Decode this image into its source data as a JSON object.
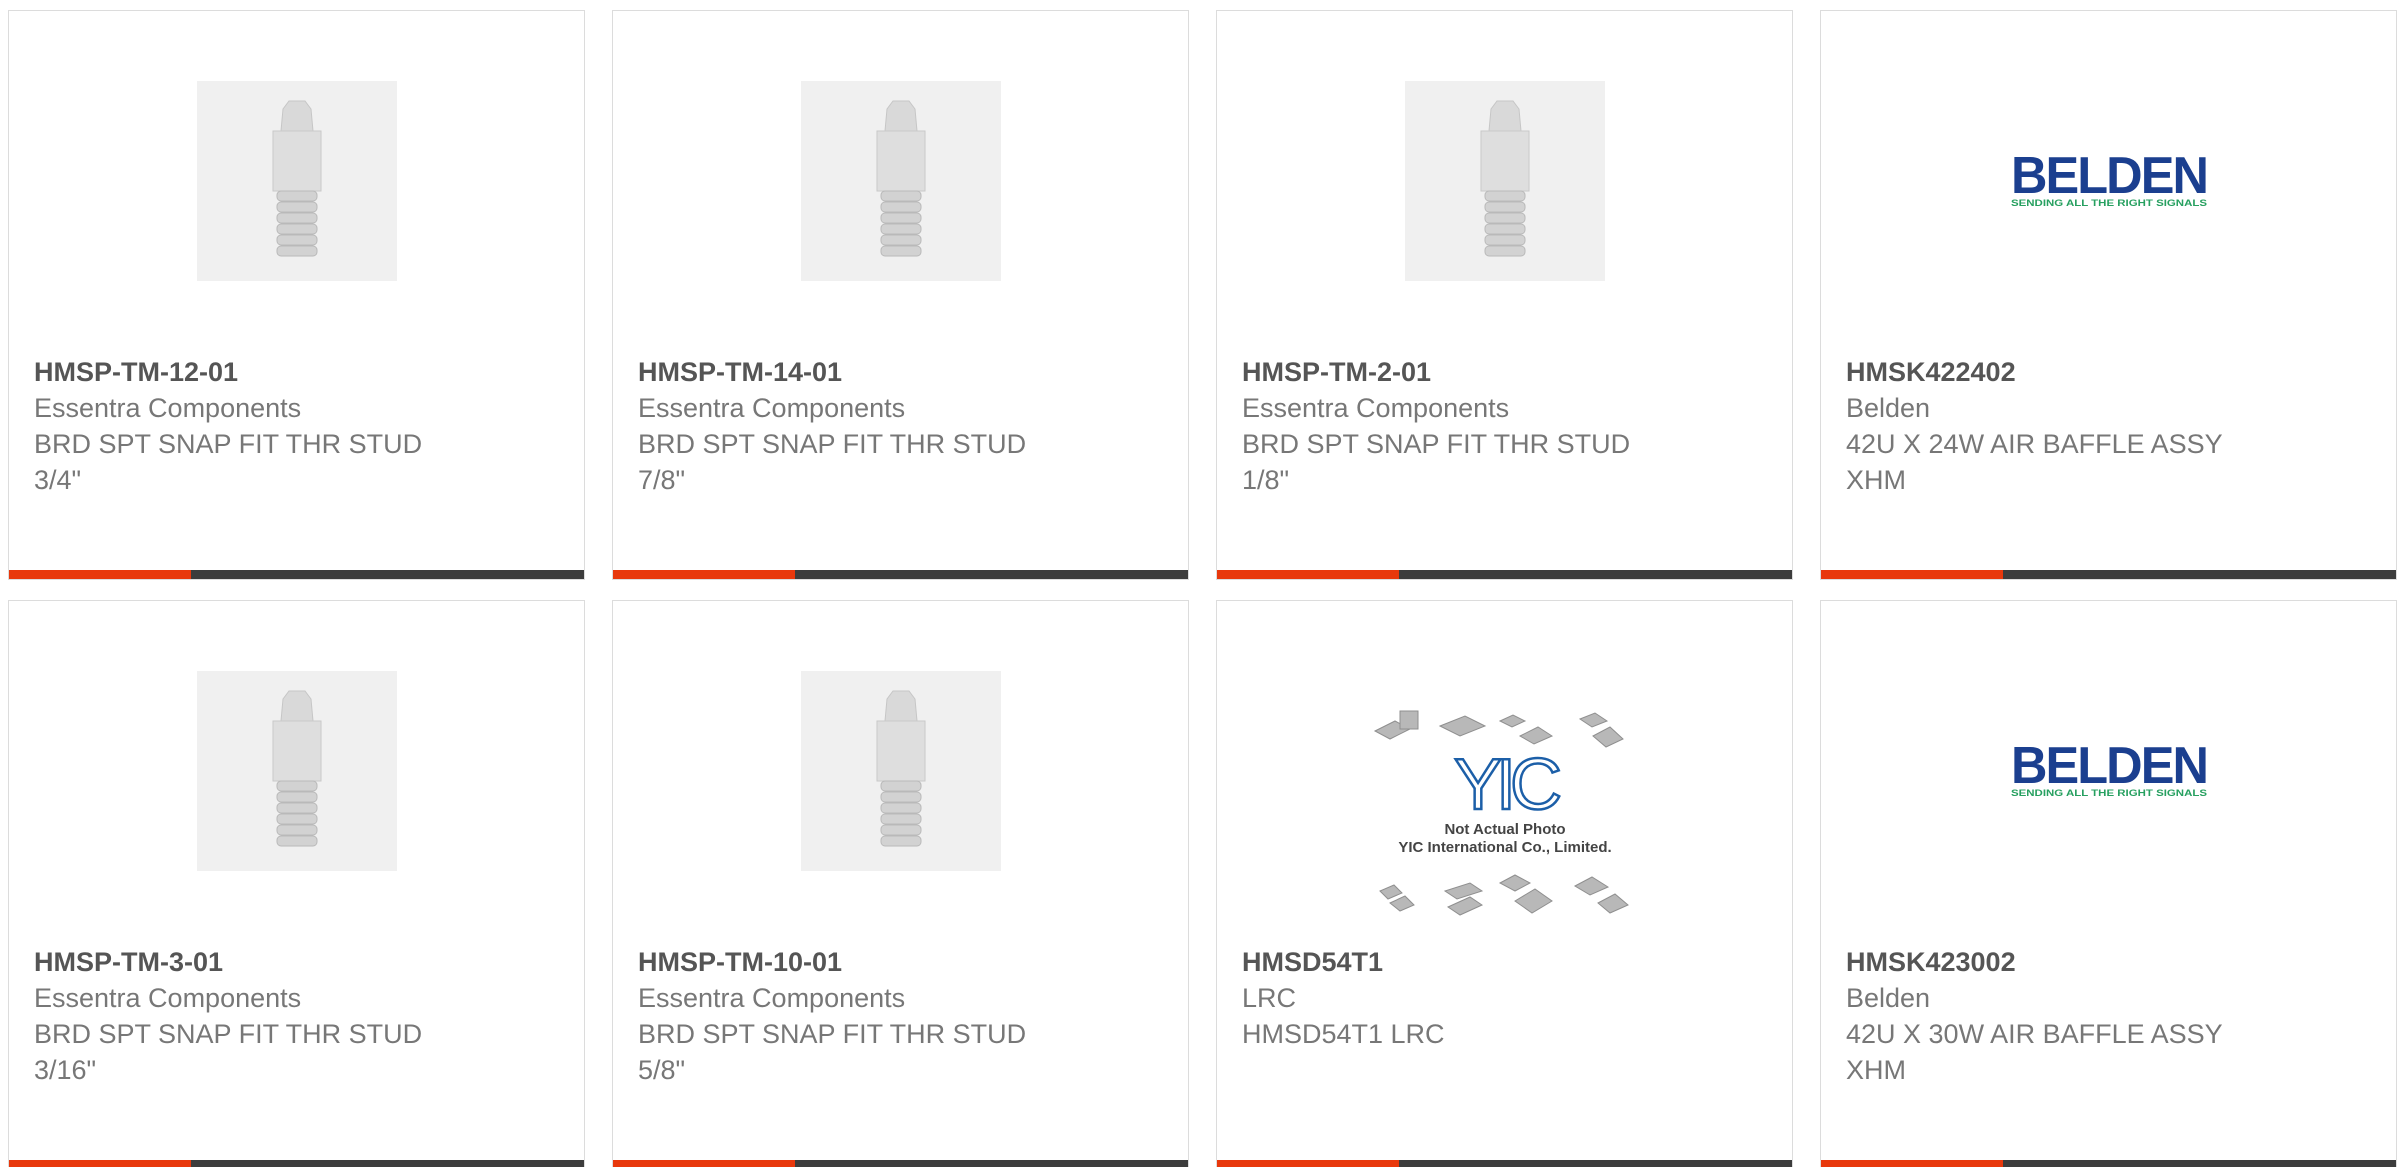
{
  "colors": {
    "accent": "#e8380c",
    "bar_dark": "#3c3c3c",
    "title_text": "#555555",
    "body_text": "#777777",
    "belden_blue": "#1b3f8f",
    "belden_green": "#27a060"
  },
  "cards": [
    {
      "image": "stud-icon",
      "part_number": "HMSP-TM-12-01",
      "manufacturer": "Essentra Components",
      "description": "BRD SPT SNAP FIT THR STUD 3/4\""
    },
    {
      "image": "stud-icon",
      "part_number": "HMSP-TM-14-01",
      "manufacturer": "Essentra Components",
      "description": "BRD SPT SNAP FIT THR STUD 7/8\""
    },
    {
      "image": "stud-icon",
      "part_number": "HMSP-TM-2-01",
      "manufacturer": "Essentra Components",
      "description": "BRD SPT SNAP FIT THR STUD 1/8\""
    },
    {
      "image": "belden-logo",
      "logo_text": "BELDEN",
      "logo_tagline": "SENDING ALL THE RIGHT SIGNALS",
      "part_number": "HMSK422402",
      "manufacturer": "Belden",
      "description": "42U X 24W AIR BAFFLE ASSY XHM"
    },
    {
      "image": "stud-icon",
      "part_number": "HMSP-TM-3-01",
      "manufacturer": "Essentra Components",
      "description": "BRD SPT SNAP FIT THR STUD 3/16\""
    },
    {
      "image": "stud-icon",
      "part_number": "HMSP-TM-10-01",
      "manufacturer": "Essentra Components",
      "description": "BRD SPT SNAP FIT THR STUD 5/8\""
    },
    {
      "image": "yic-placeholder",
      "logo_text": "YIC",
      "photo_note_1": "Not Actual Photo",
      "photo_note_2": "YIC International Co., Limited.",
      "part_number": "HMSD54T1",
      "manufacturer": "LRC",
      "description": "HMSD54T1 LRC"
    },
    {
      "image": "belden-logo",
      "logo_text": "BELDEN",
      "logo_tagline": "SENDING ALL THE RIGHT SIGNALS",
      "part_number": "HMSK423002",
      "manufacturer": "Belden",
      "description": "42U X 30W AIR BAFFLE ASSY XHM"
    }
  ]
}
